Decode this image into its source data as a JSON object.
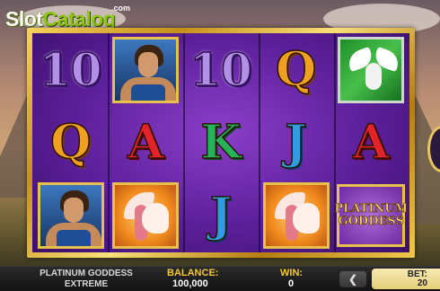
{
  "watermark": {
    "brand_left": "Slot",
    "brand_right": "Catalog",
    "suffix": ".com"
  },
  "reels": [
    [
      "10",
      "Q",
      "portrait"
    ],
    [
      "portrait",
      "A",
      "pegasus"
    ],
    [
      "10",
      "K",
      "J"
    ],
    [
      "Q",
      "J",
      "pegasus"
    ],
    [
      "dove",
      "A",
      "logo"
    ]
  ],
  "logo_tile": {
    "line1": "PLATINUM",
    "line2": "GODDESS"
  },
  "footer": {
    "game_name_line1": "PLATINUM GODDESS",
    "game_name_line2": "EXTREME",
    "balance_label": "BALANCE:",
    "balance_value": "100,000",
    "win_label": "WIN:",
    "win_value": "0",
    "bet_decrease_glyph": "❮",
    "bet_label": "BET:",
    "bet_value": "20"
  },
  "colors": {
    "frame_gold": "#e8c14c",
    "reel_purple": "#5c1f9a",
    "label_yellow": "#f6c92a",
    "bet_panel": "#f0dc95"
  }
}
